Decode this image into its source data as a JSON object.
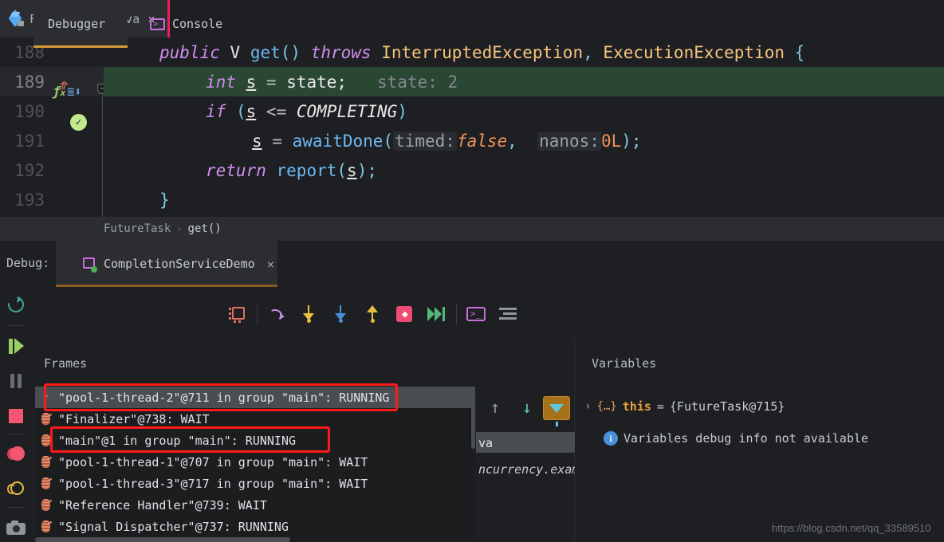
{
  "editor": {
    "tab": {
      "title": "FutureTask.java",
      "icon": "java-class-icon",
      "close": "×"
    },
    "lines": [
      {
        "num": "188"
      },
      {
        "num": "189"
      },
      {
        "num": "190"
      },
      {
        "num": "191"
      },
      {
        "num": "192"
      },
      {
        "num": "193"
      }
    ],
    "code": {
      "l188": {
        "kw_public": "public",
        "type_v": "V",
        "fn_get": "get",
        "parens": "()",
        "kw_throws": "throws",
        "ex1": "InterruptedException",
        "comma": ",",
        "ex2": "ExecutionException",
        "brace": "{"
      },
      "l189": {
        "kw_int": "int",
        "var_s": "s",
        "eq": "=",
        "field": "state;",
        "hint": "state: 2"
      },
      "l190": {
        "kw_if": "if",
        "open": "(",
        "var_s": "s",
        "op": "<=",
        "const": "COMPLETING",
        "close": ")"
      },
      "l191": {
        "var_s": "s",
        "eq": "=",
        "fn": "awaitDone",
        "open": "(",
        "hint1": "timed:",
        "val1": "false",
        "comma": ",",
        "hint2": "nanos:",
        "val2": "0L",
        "close": ");"
      },
      "l192": {
        "kw_return": "return",
        "fn": "report",
        "open": "(",
        "var_s": "s",
        "close": ");"
      },
      "l193": {
        "brace": "}"
      }
    },
    "gutter": {
      "fx_icon": "function-modified-icon",
      "override_icon": "overriding-method-icon",
      "verified_breakpoint": "verified-breakpoint-icon",
      "fold_marker": "−"
    },
    "breadcrumb": {
      "class": "FutureTask",
      "separator": "›",
      "method": "get()"
    }
  },
  "debug_header": {
    "label": "Debug:",
    "run_config": "CompletionServiceDemo",
    "close": "×"
  },
  "sidebar": {
    "items": [
      {
        "name": "rerun",
        "icon": "rerun-icon"
      },
      {
        "name": "resume",
        "icon": "resume-program-icon"
      },
      {
        "name": "pause",
        "icon": "pause-program-icon"
      },
      {
        "name": "stop",
        "icon": "stop-icon"
      },
      {
        "name": "breakpoints",
        "icon": "view-breakpoints-icon"
      },
      {
        "name": "mute-breakpoints",
        "icon": "mute-breakpoints-icon"
      },
      {
        "name": "screenshot",
        "icon": "camera-icon"
      }
    ]
  },
  "debugger_panel": {
    "tabs": [
      {
        "label": "Debugger",
        "icon": "debugger-icon",
        "active": true
      },
      {
        "label": "Console",
        "icon": "console-icon",
        "active": false
      }
    ],
    "toolbar": [
      {
        "name": "show-execution-point",
        "icon": "show-execution-point-icon"
      },
      {
        "name": "step-over",
        "icon": "step-over-icon"
      },
      {
        "name": "step-into",
        "icon": "step-into-icon"
      },
      {
        "name": "force-step-into",
        "icon": "force-step-into-icon"
      },
      {
        "name": "step-out",
        "icon": "step-out-icon"
      },
      {
        "name": "drop-frame",
        "icon": "drop-frame-icon"
      },
      {
        "name": "run-to-cursor",
        "icon": "run-to-cursor-icon"
      },
      {
        "name": "evaluate-expression",
        "icon": "evaluate-expression-icon"
      },
      {
        "name": "layout-settings",
        "icon": "settings-icon"
      }
    ]
  },
  "frames": {
    "header": "Frames",
    "nav": {
      "up": "↑",
      "down": "↓",
      "filter": "filter-icon"
    },
    "threads": [
      {
        "label": "\"pool-1-thread-2\"@711 in group \"main\": RUNNING",
        "icon": "current-thread-check-icon",
        "selected": true,
        "highlighted": true
      },
      {
        "label": "\"Finalizer\"@738: WAIT",
        "icon": "thread-icon",
        "selected": false,
        "highlighted": false
      },
      {
        "label": "\"main\"@1 in group \"main\": RUNNING",
        "icon": "thread-icon",
        "selected": false,
        "highlighted": true
      },
      {
        "label": "\"pool-1-thread-1\"@707 in group \"main\": WAIT",
        "icon": "thread-icon",
        "selected": false,
        "highlighted": false
      },
      {
        "label": "\"pool-1-thread-3\"@717 in group \"main\": WAIT",
        "icon": "thread-icon",
        "selected": false,
        "highlighted": false
      },
      {
        "label": "\"Reference Handler\"@739: WAIT",
        "icon": "thread-icon",
        "selected": false,
        "highlighted": false
      },
      {
        "label": "\"Signal Dispatcher\"@737: RUNNING",
        "icon": "thread-icon",
        "selected": false,
        "highlighted": false
      }
    ],
    "background_frames": {
      "row1": "va",
      "row2": "ncurrency.exam"
    }
  },
  "variables": {
    "header": "Variables",
    "rows": [
      {
        "chevron": "›",
        "brace": "{…}",
        "name": "this",
        "eq": "=",
        "value": "{FutureTask@715}"
      }
    ],
    "info": {
      "icon": "info-icon",
      "glyph": "i",
      "text": "Variables debug info not available"
    }
  },
  "watermark": "https://blog.csdn.net/qq_33589510"
}
